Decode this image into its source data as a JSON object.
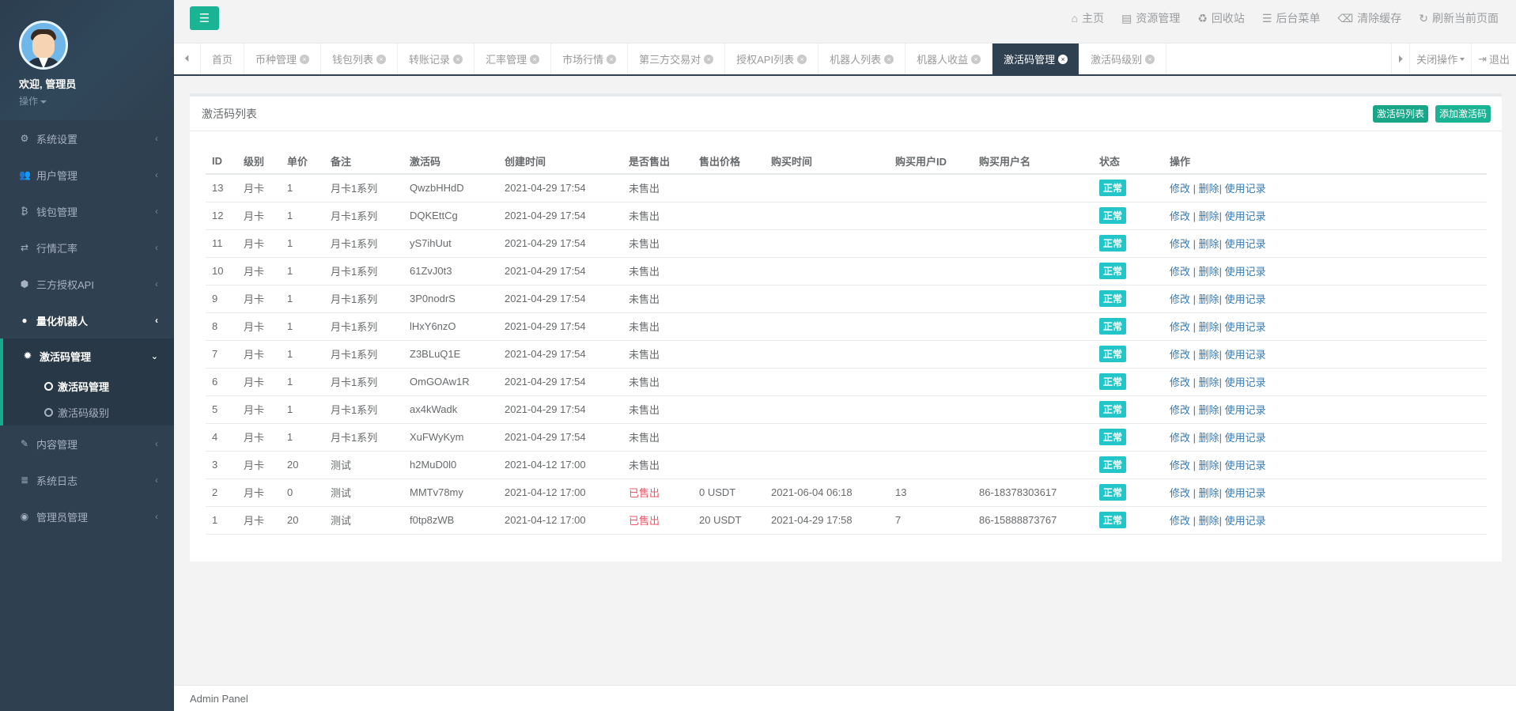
{
  "profile": {
    "welcome": "欢迎, 管理员",
    "ops": "操作"
  },
  "sidebar": {
    "items_top": [
      {
        "label": "系统设置",
        "icon": "gears-icon",
        "glyph": "⚙"
      },
      {
        "label": "用户管理",
        "icon": "users-icon",
        "glyph": "👥"
      },
      {
        "label": "钱包管理",
        "icon": "bitcoin-icon",
        "glyph": "₿"
      },
      {
        "label": "行情汇率",
        "icon": "exchange-icon",
        "glyph": "⇄"
      },
      {
        "label": "三方授权API",
        "icon": "cube-icon",
        "glyph": "⬢"
      }
    ],
    "robot": {
      "label": "量化机器人",
      "icon": "android-icon",
      "glyph": "●"
    },
    "activation": {
      "label": "激活码管理",
      "icon": "cog-icon",
      "glyph": "✹"
    },
    "sub_leaves": [
      {
        "label": "激活码管理"
      },
      {
        "label": "激活码级别"
      }
    ],
    "items_bottom": [
      {
        "label": "内容管理",
        "icon": "edit-icon",
        "glyph": "✎"
      },
      {
        "label": "系统日志",
        "icon": "database-icon",
        "glyph": "≣"
      },
      {
        "label": "管理员管理",
        "icon": "user-circle-icon",
        "glyph": "◉"
      }
    ]
  },
  "toplinks": [
    {
      "label": "主页",
      "icon": "home-icon",
      "glyph": "⌂"
    },
    {
      "label": "资源管理",
      "icon": "file-icon",
      "glyph": "▤"
    },
    {
      "label": "回收站",
      "icon": "recycle-icon",
      "glyph": "♻"
    },
    {
      "label": "后台菜单",
      "icon": "list-icon",
      "glyph": "☰"
    },
    {
      "label": "清除缓存",
      "icon": "trash-icon",
      "glyph": "⌫"
    },
    {
      "label": "刷新当前页面",
      "icon": "refresh-icon",
      "glyph": "↻"
    }
  ],
  "tabs": [
    {
      "label": "首页",
      "closable": false
    },
    {
      "label": "币种管理",
      "closable": true
    },
    {
      "label": "钱包列表",
      "closable": true
    },
    {
      "label": "转账记录",
      "closable": true
    },
    {
      "label": "汇率管理",
      "closable": true
    },
    {
      "label": "市场行情",
      "closable": true
    },
    {
      "label": "第三方交易对",
      "closable": true
    },
    {
      "label": "授权API列表",
      "closable": true
    },
    {
      "label": "机器人列表",
      "closable": true
    },
    {
      "label": "机器人收益",
      "closable": true
    },
    {
      "label": "激活码管理",
      "closable": true,
      "active": true
    },
    {
      "label": "激活码级别",
      "closable": true
    }
  ],
  "tab_tools": {
    "close_ops": "关闭操作",
    "logout": "退出"
  },
  "panel": {
    "title": "激活码列表",
    "btn_list": "激活码列表",
    "btn_add": "添加激活码"
  },
  "table": {
    "headers": [
      "ID",
      "级别",
      "单价",
      "备注",
      "激活码",
      "创建时间",
      "是否售出",
      "售出价格",
      "购买时间",
      "购买用户ID",
      "购买用户名",
      "状态",
      "操作"
    ],
    "rows": [
      [
        "13",
        "月卡",
        "1",
        "月卡1系列",
        "QwzbHHdD",
        "2021-04-29 17:54",
        "未售出",
        "",
        "",
        "",
        "",
        "正常"
      ],
      [
        "12",
        "月卡",
        "1",
        "月卡1系列",
        "DQKEttCg",
        "2021-04-29 17:54",
        "未售出",
        "",
        "",
        "",
        "",
        "正常"
      ],
      [
        "11",
        "月卡",
        "1",
        "月卡1系列",
        "yS7ihUut",
        "2021-04-29 17:54",
        "未售出",
        "",
        "",
        "",
        "",
        "正常"
      ],
      [
        "10",
        "月卡",
        "1",
        "月卡1系列",
        "61ZvJ0t3",
        "2021-04-29 17:54",
        "未售出",
        "",
        "",
        "",
        "",
        "正常"
      ],
      [
        "9",
        "月卡",
        "1",
        "月卡1系列",
        "3P0nodrS",
        "2021-04-29 17:54",
        "未售出",
        "",
        "",
        "",
        "",
        "正常"
      ],
      [
        "8",
        "月卡",
        "1",
        "月卡1系列",
        "lHxY6nzO",
        "2021-04-29 17:54",
        "未售出",
        "",
        "",
        "",
        "",
        "正常"
      ],
      [
        "7",
        "月卡",
        "1",
        "月卡1系列",
        "Z3BLuQ1E",
        "2021-04-29 17:54",
        "未售出",
        "",
        "",
        "",
        "",
        "正常"
      ],
      [
        "6",
        "月卡",
        "1",
        "月卡1系列",
        "OmGOAw1R",
        "2021-04-29 17:54",
        "未售出",
        "",
        "",
        "",
        "",
        "正常"
      ],
      [
        "5",
        "月卡",
        "1",
        "月卡1系列",
        "ax4kWadk",
        "2021-04-29 17:54",
        "未售出",
        "",
        "",
        "",
        "",
        "正常"
      ],
      [
        "4",
        "月卡",
        "1",
        "月卡1系列",
        "XuFWyKym",
        "2021-04-29 17:54",
        "未售出",
        "",
        "",
        "",
        "",
        "正常"
      ],
      [
        "3",
        "月卡",
        "20",
        "测试",
        "h2MuD0l0",
        "2021-04-12 17:00",
        "未售出",
        "",
        "",
        "",
        "",
        "正常"
      ],
      [
        "2",
        "月卡",
        "0",
        "测试",
        "MMTv78my",
        "2021-04-12 17:00",
        "已售出",
        "0 USDT",
        "2021-06-04 06:18",
        "13",
        "86-18378303617",
        "正常"
      ],
      [
        "1",
        "月卡",
        "20",
        "测试",
        "f0tp8zWB",
        "2021-04-12 17:00",
        "已售出",
        "20 USDT",
        "2021-04-29 17:58",
        "7",
        "86-15888873767",
        "正常"
      ]
    ],
    "actions": {
      "edit": "修改",
      "delete": "删除",
      "usage": "使用记录"
    }
  },
  "footer": "Admin Panel",
  "colors": {
    "accent": "#1ab394",
    "sidebar": "#2f4050",
    "sold": "#ed5565",
    "badge": "#23c6c8",
    "link": "#337ab7"
  }
}
